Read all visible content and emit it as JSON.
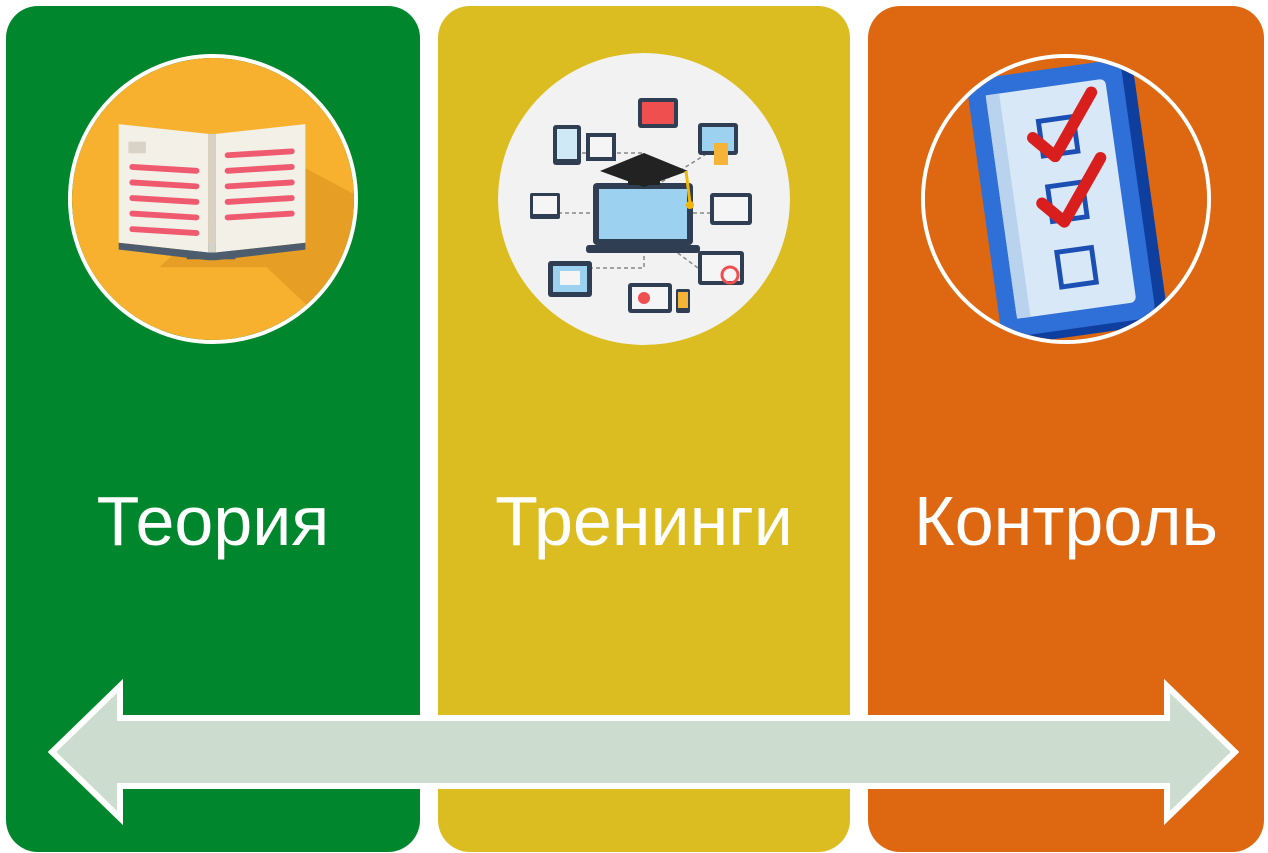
{
  "colors": {
    "panel_1": "#00862d",
    "panel_2": "#dbbd22",
    "panel_3": "#dd6811",
    "arrow_fill": "#ccdccf",
    "arrow_stroke": "#ffffff"
  },
  "panels": [
    {
      "label": "Теория",
      "icon": "book-icon"
    },
    {
      "label": "Тренинги",
      "icon": "e-learning-devices-icon"
    },
    {
      "label": "Контроль",
      "icon": "checklist-icon"
    }
  ]
}
